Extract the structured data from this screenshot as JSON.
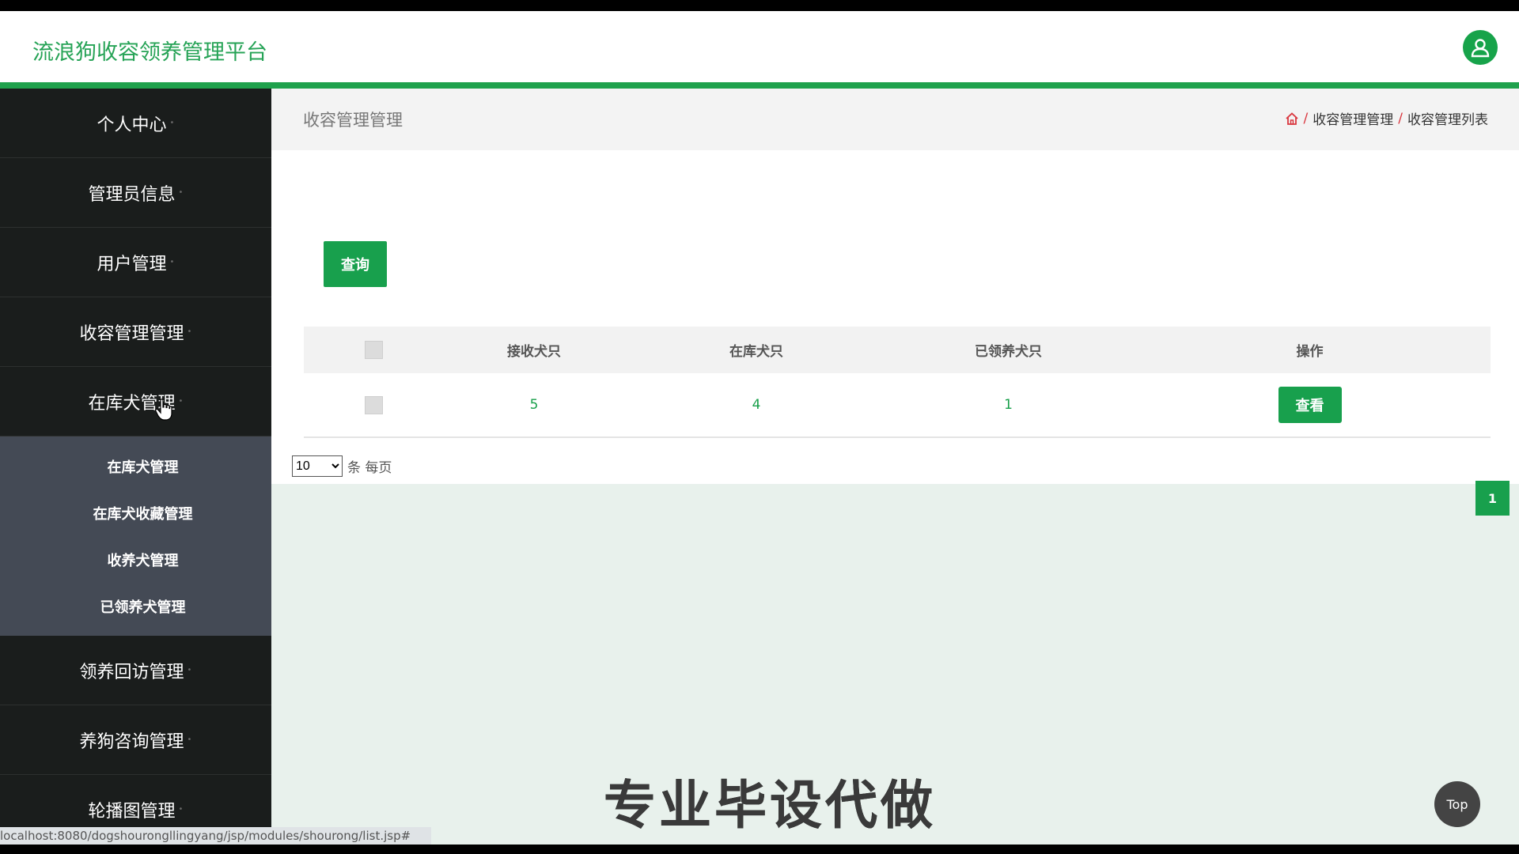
{
  "header": {
    "title": "流浪狗收容领养管理平台",
    "avatar_icon": "user-icon"
  },
  "sidebar": {
    "items": [
      {
        "label": "个人中心"
      },
      {
        "label": "管理员信息"
      },
      {
        "label": "用户管理"
      },
      {
        "label": "收容管理管理"
      },
      {
        "label": "在库犬管理"
      },
      {
        "label": "领养回访管理"
      },
      {
        "label": "养狗咨询管理"
      },
      {
        "label": "轮播图管理"
      }
    ],
    "submenu": [
      {
        "label": "在库犬管理"
      },
      {
        "label": "在库犬收藏管理"
      },
      {
        "label": "收养犬管理"
      },
      {
        "label": "已领养犬管理"
      }
    ]
  },
  "page": {
    "title": "收容管理管理",
    "breadcrumb": [
      "收容管理管理",
      "收容管理列表"
    ],
    "query_label": "查询"
  },
  "table": {
    "columns": [
      "接收犬只",
      "在库犬只",
      "已领养犬只",
      "操作"
    ],
    "rows": [
      {
        "received": "5",
        "in_stock": "4",
        "adopted": "1",
        "action": "查看"
      }
    ]
  },
  "pagination": {
    "page_size": "10",
    "page_size_options": [
      "10"
    ],
    "per_page_label": "条 每页",
    "current_page": "1"
  },
  "overlay": {
    "watermark": "专业毕设代做",
    "top_label": "Top"
  },
  "status_bar": {
    "url": "localhost:8080/dogshourongllingyang/jsp/modules/shourong/list.jsp#"
  },
  "colors": {
    "accent": "#18a04d",
    "sidebar_bg": "#1a1d1c",
    "submenu_bg": "#444a55"
  }
}
